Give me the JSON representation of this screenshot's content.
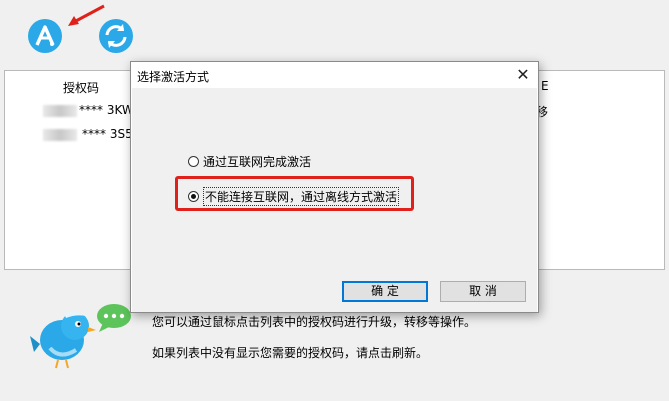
{
  "table": {
    "col_license": "授权码",
    "col_right_partial": "E",
    "rows": [
      {
        "code": "**** 3KW",
        "action": "移"
      },
      {
        "code": "**** 3S5",
        "action": ""
      }
    ]
  },
  "hints": {
    "line1": "您可以通过鼠标点击列表中的授权码进行升级，转移等操作。",
    "line2": "如果列表中没有显示您需要的授权码，请点击刷新。"
  },
  "dialog": {
    "title": "选择激活方式",
    "close_glyph": "✕",
    "option_online": "通过互联网完成激活",
    "option_offline": "不能连接互联网，通过离线方式激活",
    "selected": "offline",
    "ok_label": "确 定",
    "cancel_label": "取 消"
  },
  "colors": {
    "brand_blue": "#2aa8e8",
    "highlight_red": "#e0201b",
    "bubble_green": "#5cc45a"
  }
}
